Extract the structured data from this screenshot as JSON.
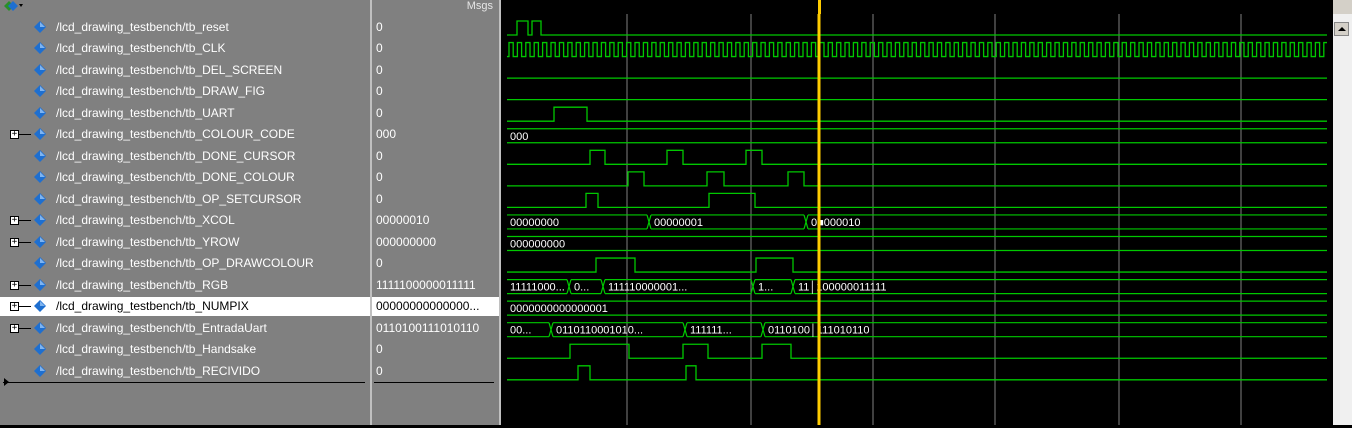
{
  "header": {
    "values_column_title": "Msgs"
  },
  "colors": {
    "wave": "#00c800",
    "cursor": "#ffcc00",
    "grid": "#808080",
    "value_text": "#ffffff",
    "diamond_fill": "#1e6fd0"
  },
  "cursor": {
    "time_ns": 0
  },
  "signals": [
    {
      "name": "/lcd_drawing_testbench/tb_reset",
      "value": "0",
      "expandable": false
    },
    {
      "name": "/lcd_drawing_testbench/tb_CLK",
      "value": "0",
      "expandable": false
    },
    {
      "name": "/lcd_drawing_testbench/tb_DEL_SCREEN",
      "value": "0",
      "expandable": false
    },
    {
      "name": "/lcd_drawing_testbench/tb_DRAW_FIG",
      "value": "0",
      "expandable": false
    },
    {
      "name": "/lcd_drawing_testbench/tb_UART",
      "value": "0",
      "expandable": false
    },
    {
      "name": "/lcd_drawing_testbench/tb_COLOUR_CODE",
      "value": "000",
      "expandable": true
    },
    {
      "name": "/lcd_drawing_testbench/tb_DONE_CURSOR",
      "value": "0",
      "expandable": false
    },
    {
      "name": "/lcd_drawing_testbench/tb_DONE_COLOUR",
      "value": "0",
      "expandable": false
    },
    {
      "name": "/lcd_drawing_testbench/tb_OP_SETCURSOR",
      "value": "0",
      "expandable": false
    },
    {
      "name": "/lcd_drawing_testbench/tb_XCOL",
      "value": "00000010",
      "expandable": true
    },
    {
      "name": "/lcd_drawing_testbench/tb_YROW",
      "value": "000000000",
      "expandable": true
    },
    {
      "name": "/lcd_drawing_testbench/tb_OP_DRAWCOLOUR",
      "value": "0",
      "expandable": false
    },
    {
      "name": "/lcd_drawing_testbench/tb_RGB",
      "value": "1111100000011111",
      "expandable": true
    },
    {
      "name": "/lcd_drawing_testbench/tb_NUMPIX",
      "value": "00000000000000...",
      "expandable": true,
      "selected": true
    },
    {
      "name": "/lcd_drawing_testbench/tb_EntradaUart",
      "value": "0110100111010110",
      "expandable": true
    },
    {
      "name": "/lcd_drawing_testbench/tb_Handsake",
      "value": "0",
      "expandable": false
    },
    {
      "name": "/lcd_drawing_testbench/tb_RECIVIDO",
      "value": "0",
      "expandable": false
    }
  ],
  "waveform_labels": {
    "colour_code": [
      "000"
    ],
    "xcol": [
      "00000000",
      "00000001",
      "0■000010"
    ],
    "yrow": [
      "000000000"
    ],
    "rgb": [
      "11111000...",
      "0...",
      "111110000001...",
      "1...",
      "11│100000011111"
    ],
    "numpix": [
      "0000000000000001"
    ],
    "entrada_uart": [
      "00...",
      "0110110001010...",
      "111111...",
      "0110100│111010110"
    ]
  }
}
